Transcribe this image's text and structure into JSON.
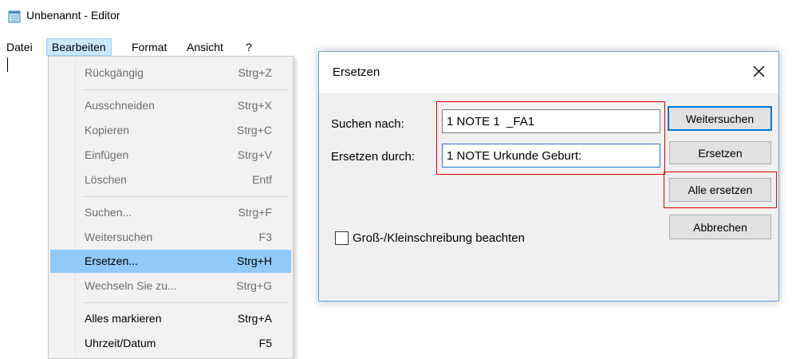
{
  "window": {
    "title": "Unbenannt - Editor",
    "icon": "notepad-icon"
  },
  "menubar": {
    "items": [
      "Datei",
      "Bearbeiten",
      "Format",
      "Ansicht",
      "?"
    ],
    "active": "Bearbeiten"
  },
  "edit_menu": {
    "items": [
      {
        "label": "Rückgängig",
        "shortcut": "Strg+Z",
        "enabled": false
      },
      {
        "label": "Ausschneiden",
        "shortcut": "Strg+X",
        "enabled": false
      },
      {
        "label": "Kopieren",
        "shortcut": "Strg+C",
        "enabled": false
      },
      {
        "label": "Einfügen",
        "shortcut": "Strg+V",
        "enabled": false
      },
      {
        "label": "Löschen",
        "shortcut": "Entf",
        "enabled": false
      },
      {
        "label": "Suchen...",
        "shortcut": "Strg+F",
        "enabled": false
      },
      {
        "label": "Weitersuchen",
        "shortcut": "F3",
        "enabled": false
      },
      {
        "label": "Ersetzen...",
        "shortcut": "Strg+H",
        "enabled": true,
        "highlighted": true
      },
      {
        "label": "Wechseln Sie zu...",
        "shortcut": "Strg+G",
        "enabled": false
      },
      {
        "label": "Alles markieren",
        "shortcut": "Strg+A",
        "enabled": true
      },
      {
        "label": "Uhrzeit/Datum",
        "shortcut": "F5",
        "enabled": true
      }
    ]
  },
  "replace_dialog": {
    "title": "Ersetzen",
    "close_icon": "close-icon",
    "search_label": "Suchen nach:",
    "search_value": "1 NOTE 1  _FA1",
    "replace_label": "Ersetzen durch:",
    "replace_value": "1 NOTE Urkunde Geburt:",
    "buttons": {
      "find_next": "Weitersuchen",
      "replace": "Ersetzen",
      "replace_all": "Alle ersetzen",
      "cancel": "Abbrechen"
    },
    "match_case_label": "Groß-/Kleinschreibung beachten",
    "match_case_checked": false
  },
  "colors": {
    "menu_highlight": "#91c9f7",
    "annotation_red": "#e00000",
    "focus_blue": "#0078d7"
  }
}
